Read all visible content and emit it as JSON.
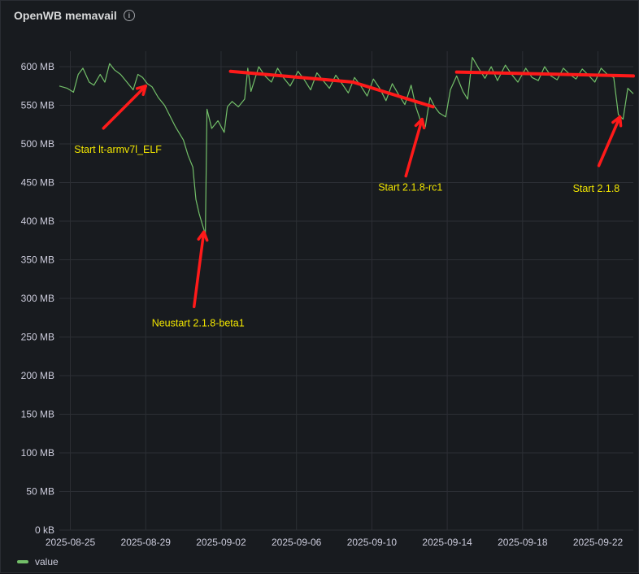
{
  "panel": {
    "title": "OpenWB memavail",
    "info_icon": "info-circle-icon"
  },
  "legend": [
    {
      "label": "value",
      "color": "#73bf69"
    }
  ],
  "colors": {
    "series": "#73bf69",
    "annotation_line": "#ff1a1a",
    "annotation_text": "#f2e600",
    "grid": "#2c2f35",
    "background": "#181b1f"
  },
  "chart_data": {
    "type": "line",
    "xlabel": "",
    "ylabel": "",
    "ylim": [
      0,
      620
    ],
    "xlim": [
      "2025-08-24T10:00",
      "2025-09-23T21:00"
    ],
    "y_ticks": [
      0,
      50,
      100,
      150,
      200,
      250,
      300,
      350,
      400,
      450,
      500,
      550,
      600
    ],
    "y_tick_labels": [
      "0 kB",
      "50 MB",
      "100 MB",
      "150 MB",
      "200 MB",
      "250 MB",
      "300 MB",
      "350 MB",
      "400 MB",
      "450 MB",
      "500 MB",
      "550 MB",
      "600 MB"
    ],
    "x_ticks": [
      "2025-08-25",
      "2025-08-29",
      "2025-09-02",
      "2025-09-06",
      "2025-09-10",
      "2025-09-14",
      "2025-09-18",
      "2025-09-22"
    ],
    "grid": true,
    "legend_position": "bottom-left",
    "series": [
      {
        "name": "value",
        "color": "#73bf69",
        "points": [
          [
            "2025-08-24T10:00",
            575
          ],
          [
            "2025-08-24T20:00",
            572
          ],
          [
            "2025-08-25T04:00",
            567
          ],
          [
            "2025-08-25T10:00",
            590
          ],
          [
            "2025-08-25T16:00",
            598
          ],
          [
            "2025-08-26T00:00",
            580
          ],
          [
            "2025-08-26T06:00",
            576
          ],
          [
            "2025-08-26T14:00",
            590
          ],
          [
            "2025-08-26T20:00",
            580
          ],
          [
            "2025-08-27T02:00",
            604
          ],
          [
            "2025-08-27T08:00",
            596
          ],
          [
            "2025-08-27T16:00",
            590
          ],
          [
            "2025-08-28T00:00",
            580
          ],
          [
            "2025-08-28T08:00",
            570
          ],
          [
            "2025-08-28T14:00",
            590
          ],
          [
            "2025-08-28T20:00",
            586
          ],
          [
            "2025-08-29T02:00",
            578
          ],
          [
            "2025-08-29T08:00",
            574
          ],
          [
            "2025-08-29T16:00",
            560
          ],
          [
            "2025-08-30T00:00",
            550
          ],
          [
            "2025-08-30T06:00",
            538
          ],
          [
            "2025-08-30T14:00",
            522
          ],
          [
            "2025-08-31T00:00",
            505
          ],
          [
            "2025-08-31T06:00",
            485
          ],
          [
            "2025-08-31T12:00",
            470
          ],
          [
            "2025-08-31T16:00",
            428
          ],
          [
            "2025-08-31T20:00",
            410
          ],
          [
            "2025-09-01T00:00",
            396
          ],
          [
            "2025-09-01T04:00",
            383
          ],
          [
            "2025-09-01T06:00",
            545
          ],
          [
            "2025-09-01T12:00",
            520
          ],
          [
            "2025-09-01T20:00",
            530
          ],
          [
            "2025-09-02T04:00",
            515
          ],
          [
            "2025-09-02T08:00",
            548
          ],
          [
            "2025-09-02T14:00",
            555
          ],
          [
            "2025-09-02T22:00",
            548
          ],
          [
            "2025-09-03T06:00",
            558
          ],
          [
            "2025-09-03T10:00",
            598
          ],
          [
            "2025-09-03T14:00",
            568
          ],
          [
            "2025-09-04T00:00",
            600
          ],
          [
            "2025-09-04T08:00",
            588
          ],
          [
            "2025-09-04T16:00",
            580
          ],
          [
            "2025-09-05T00:00",
            598
          ],
          [
            "2025-09-05T08:00",
            585
          ],
          [
            "2025-09-05T16:00",
            575
          ],
          [
            "2025-09-06T02:00",
            594
          ],
          [
            "2025-09-06T10:00",
            583
          ],
          [
            "2025-09-06T18:00",
            570
          ],
          [
            "2025-09-07T02:00",
            592
          ],
          [
            "2025-09-07T10:00",
            582
          ],
          [
            "2025-09-07T18:00",
            572
          ],
          [
            "2025-09-08T02:00",
            589
          ],
          [
            "2025-09-08T10:00",
            578
          ],
          [
            "2025-09-08T18:00",
            566
          ],
          [
            "2025-09-09T02:00",
            586
          ],
          [
            "2025-09-09T10:00",
            575
          ],
          [
            "2025-09-09T18:00",
            562
          ],
          [
            "2025-09-10T02:00",
            584
          ],
          [
            "2025-09-10T10:00",
            572
          ],
          [
            "2025-09-10T18:00",
            556
          ],
          [
            "2025-09-11T02:00",
            578
          ],
          [
            "2025-09-11T10:00",
            564
          ],
          [
            "2025-09-11T18:00",
            551
          ],
          [
            "2025-09-12T02:00",
            576
          ],
          [
            "2025-09-12T08:00",
            548
          ],
          [
            "2025-09-12T14:00",
            530
          ],
          [
            "2025-09-12T20:00",
            522
          ],
          [
            "2025-09-13T02:00",
            560
          ],
          [
            "2025-09-13T08:00",
            548
          ],
          [
            "2025-09-13T14:00",
            540
          ],
          [
            "2025-09-13T22:00",
            535
          ],
          [
            "2025-09-14T04:00",
            570
          ],
          [
            "2025-09-14T12:00",
            588
          ],
          [
            "2025-09-14T20:00",
            568
          ],
          [
            "2025-09-15T02:00",
            558
          ],
          [
            "2025-09-15T08:00",
            612
          ],
          [
            "2025-09-15T16:00",
            598
          ],
          [
            "2025-09-16T00:00",
            585
          ],
          [
            "2025-09-16T08:00",
            600
          ],
          [
            "2025-09-16T16:00",
            582
          ],
          [
            "2025-09-17T02:00",
            602
          ],
          [
            "2025-09-17T10:00",
            590
          ],
          [
            "2025-09-17T18:00",
            580
          ],
          [
            "2025-09-18T04:00",
            598
          ],
          [
            "2025-09-18T12:00",
            586
          ],
          [
            "2025-09-18T20:00",
            582
          ],
          [
            "2025-09-19T04:00",
            600
          ],
          [
            "2025-09-19T12:00",
            588
          ],
          [
            "2025-09-19T20:00",
            583
          ],
          [
            "2025-09-20T04:00",
            598
          ],
          [
            "2025-09-20T12:00",
            590
          ],
          [
            "2025-09-20T20:00",
            584
          ],
          [
            "2025-09-21T04:00",
            597
          ],
          [
            "2025-09-21T12:00",
            589
          ],
          [
            "2025-09-21T20:00",
            580
          ],
          [
            "2025-09-22T04:00",
            598
          ],
          [
            "2025-09-22T12:00",
            590
          ],
          [
            "2025-09-22T20:00",
            586
          ],
          [
            "2025-09-23T02:00",
            538
          ],
          [
            "2025-09-23T08:00",
            532
          ],
          [
            "2025-09-23T14:00",
            572
          ],
          [
            "2025-09-23T21:00",
            565
          ]
        ]
      }
    ],
    "annotations": [
      {
        "text": "Start lt-armv7l_ELF",
        "point": [
          "2025-08-29T00:00",
          575
        ]
      },
      {
        "text": "Neustart 2.1.8-beta1",
        "point": [
          "2025-09-01T02:00",
          386
        ]
      },
      {
        "text": "Start 2.1.8-rc1",
        "point": [
          "2025-09-12T16:00",
          532
        ]
      },
      {
        "text": "Start 2.1.8",
        "point": [
          "2025-09-23T04:00",
          535
        ]
      }
    ],
    "trend_lines": [
      {
        "from": [
          "2025-09-02T12:00",
          594
        ],
        "to": [
          "2025-09-09T00:00",
          580
        ]
      },
      {
        "from": [
          "2025-09-09T00:00",
          580
        ],
        "to": [
          "2025-09-13T06:00",
          548
        ]
      },
      {
        "from": [
          "2025-09-14T12:00",
          593
        ],
        "to": [
          "2025-09-23T21:00",
          588
        ]
      }
    ]
  }
}
